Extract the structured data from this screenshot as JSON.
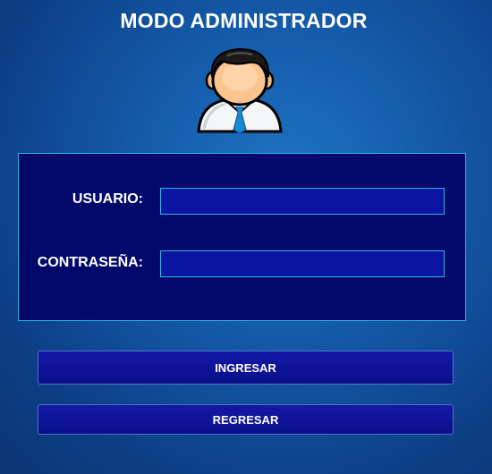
{
  "header": {
    "title": "MODO ADMINISTRADOR",
    "avatar_icon": "admin-user-icon"
  },
  "form": {
    "username_label": "USUARIO:",
    "username_value": "",
    "password_label": "CONTRASEÑA:",
    "password_value": ""
  },
  "actions": {
    "login_label": "INGRESAR",
    "back_label": "REGRESAR"
  },
  "colors": {
    "background": "#145aa8",
    "panel": "#03096a",
    "field": "#0a14a0",
    "border_accent": "#2fb4e6",
    "button": "#0a0f8a"
  }
}
